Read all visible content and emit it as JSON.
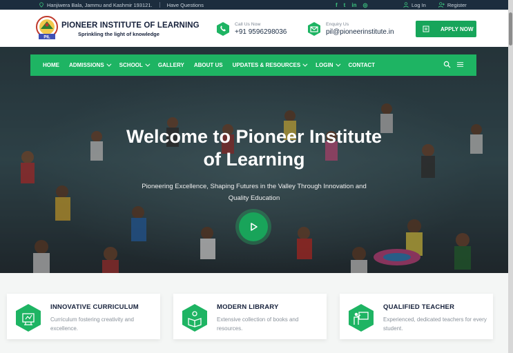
{
  "topbar": {
    "address": "Hanjiwera Bala, Jammu and Kashmir 193121.",
    "faq": "Have Questions",
    "social_icons": [
      "facebook-icon",
      "twitter-icon",
      "linkedin-icon",
      "instagram-icon"
    ],
    "social_glyphs": [
      "f",
      "t",
      "in",
      "◎"
    ],
    "login": "Log In",
    "register": "Register"
  },
  "header": {
    "brand_name": "PIONEER INSTITUTE OF LEARNING",
    "tagline": "Sprinkling the light of knowledge",
    "logo_text": "PIL",
    "call_label": "Call Us Now",
    "call_value": "+91 9596298036",
    "enquiry_label": "Enquiry Us",
    "enquiry_value": "pil@pioneerinstitute.in",
    "apply_label": "APPLY NOW"
  },
  "nav": {
    "items": [
      {
        "label": "HOME",
        "dropdown": false
      },
      {
        "label": "ADMISSIONS",
        "dropdown": true
      },
      {
        "label": "SCHOOL",
        "dropdown": true
      },
      {
        "label": "GALLERY",
        "dropdown": false
      },
      {
        "label": "ABOUT US",
        "dropdown": false
      },
      {
        "label": "UPDATES & RESOURCES",
        "dropdown": true
      },
      {
        "label": "LOGIN",
        "dropdown": true
      },
      {
        "label": "CONTACT",
        "dropdown": false
      }
    ]
  },
  "hero": {
    "title_line1": "Welcome to Pioneer Institute",
    "title_line2": "of Learning",
    "subtitle_line1": "Pioneering Excellence, Shaping Futures in the Valley Through Innovation and",
    "subtitle_line2": "Quality Education"
  },
  "features": [
    {
      "title": "INNOVATIVE CURRICULUM",
      "desc": "Curriculum fostering creativity and excellence.",
      "icon": "curriculum-icon"
    },
    {
      "title": "MODERN LIBRARY",
      "desc": "Extensive collection of books and resources.",
      "icon": "library-icon"
    },
    {
      "title": "QUALIFIED TEACHER",
      "desc": "Experienced, dedicated teachers for every student.",
      "icon": "teacher-icon"
    }
  ],
  "colors": {
    "accent": "#1eb463",
    "topbar": "#1c2d3e",
    "heading": "#16213b"
  }
}
